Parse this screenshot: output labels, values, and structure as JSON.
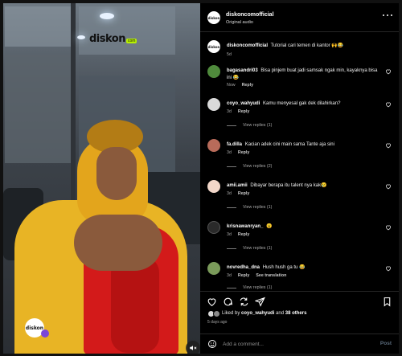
{
  "video": {
    "logo_word": "diskon",
    "logo_sub": "com",
    "creator_badge": "diskon"
  },
  "header": {
    "username": "diskoncomofficial",
    "audio": "Original audio"
  },
  "caption": {
    "username": "diskoncomofficial",
    "text": "Tutorial cari temen di kantor 🙌😂",
    "time": "5d"
  },
  "comments": [
    {
      "username": "bagasandri03",
      "text": "Bisa pinjem buat jadi samsak ngak min, kayaknya bisa ini 😂",
      "time": "Now",
      "reply": "Reply",
      "see_translation": "",
      "view_replies": "",
      "avatar_color": "#4f8a3c"
    },
    {
      "username": "coyo_wahyudi",
      "text": "Kamu menyesal gak dek dilahirkan?",
      "time": "3d",
      "reply": "Reply",
      "see_translation": "",
      "view_replies": "View replies (1)",
      "avatar_color": "#d9d9d9"
    },
    {
      "username": "fa.dilla",
      "text": "Kacian adek cini main sama Tante aja sini",
      "time": "3d",
      "reply": "Reply",
      "see_translation": "",
      "view_replies": "View replies (2)",
      "avatar_color": "#b86b5a"
    },
    {
      "username": "amii.amii",
      "text": "Dibayar berapa itu talent nya kak😢",
      "time": "3d",
      "reply": "Reply",
      "see_translation": "",
      "view_replies": "View replies (1)",
      "avatar_color": "#f2d7c9"
    },
    {
      "username": "krisnawanryan_",
      "text": "😮",
      "time": "3d",
      "reply": "Reply",
      "see_translation": "",
      "view_replies": "View replies (1)",
      "avatar_color": "#2a2a2a"
    },
    {
      "username": "novredha_dna",
      "text": "Hush hush ga tu 😂",
      "time": "3d",
      "reply": "Reply",
      "see_translation": "See translation",
      "view_replies": "View replies (1)",
      "avatar_color": "#7a9a5a"
    }
  ],
  "likes": {
    "prefix": "Liked by",
    "user": "coyo_wahyudi",
    "joiner": "and",
    "others": "38 others"
  },
  "posted_ago": "5 days ago",
  "composer": {
    "placeholder": "Add a comment...",
    "post_label": "Post"
  },
  "colors": {
    "panel_bg": "#000000",
    "like_red": "#ffffff",
    "post_disabled": "#5c6d7e"
  }
}
